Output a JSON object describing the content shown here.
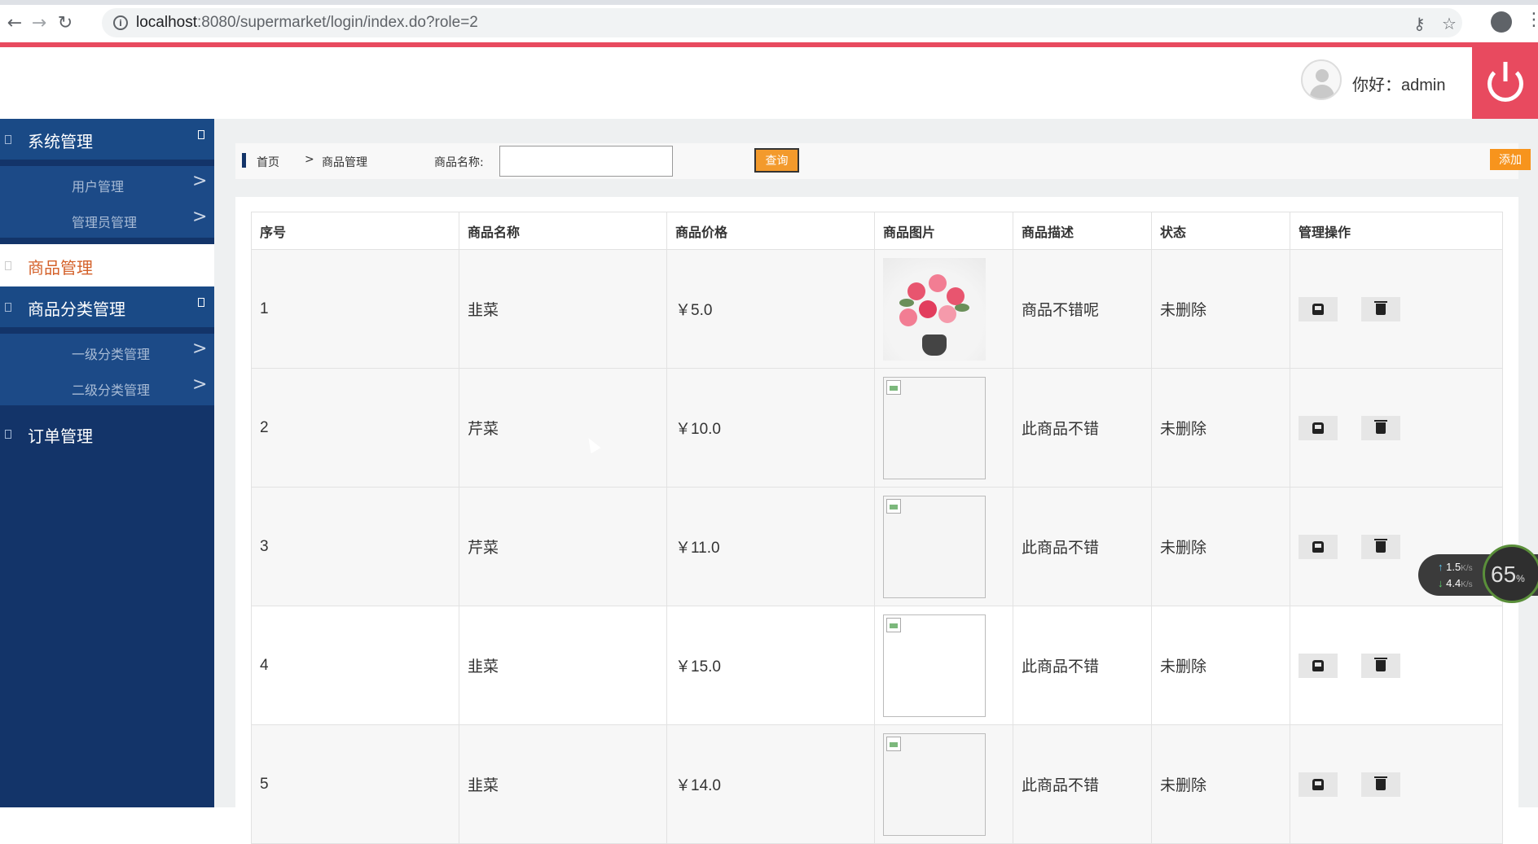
{
  "browser": {
    "url_host": "localhost",
    "url_rest": ":8080/supermarket/login/index.do?role=2",
    "back_icon": "arrow-left-icon",
    "forward_icon": "arrow-right-icon",
    "reload_icon": "reload-icon"
  },
  "header": {
    "greeting": "你好：admin",
    "accent_color": "#e84a5f"
  },
  "sidebar": {
    "groups": [
      {
        "label": "系统管理",
        "items": [
          {
            "label": "用户管理",
            "arrow": ">"
          },
          {
            "label": "管理员管理",
            "arrow": ">"
          }
        ]
      },
      {
        "label": "商品管理",
        "active": true
      },
      {
        "label": "商品分类管理",
        "items": [
          {
            "label": "一级分类管理",
            "arrow": ">"
          },
          {
            "label": "二级分类管理",
            "arrow": ">"
          }
        ]
      },
      {
        "label": "订单管理"
      }
    ],
    "bg_color": "#133469"
  },
  "toolbar": {
    "breadcrumb_home": "首页",
    "breadcrumb_sep": ">",
    "breadcrumb_current": "商品管理",
    "search_label": "商品名称:",
    "search_value": "",
    "search_button": "查询",
    "add_button": "添加"
  },
  "table": {
    "headers": [
      "序号",
      "商品名称",
      "商品价格",
      "商品图片",
      "商品描述",
      "状态",
      "管理操作"
    ],
    "rows": [
      {
        "id": "1",
        "name": "韭菜",
        "price": "￥5.0",
        "image": "flower-photo",
        "desc": "商品不错呢",
        "status": "未删除"
      },
      {
        "id": "2",
        "name": "芹菜",
        "price": "￥10.0",
        "image": "broken-image",
        "desc": "此商品不错",
        "status": "未删除"
      },
      {
        "id": "3",
        "name": "芹菜",
        "price": "￥11.0",
        "image": "broken-image",
        "desc": "此商品不错",
        "status": "未删除"
      },
      {
        "id": "4",
        "name": "韭菜",
        "price": "￥15.0",
        "image": "broken-image",
        "desc": "此商品不错",
        "status": "未删除"
      },
      {
        "id": "5",
        "name": "韭菜",
        "price": "￥14.0",
        "image": "broken-image",
        "desc": "此商品不错",
        "status": "未删除"
      }
    ]
  },
  "net_widget": {
    "up": "1.5",
    "down": "4.4",
    "unit": "K/s",
    "percent": "65",
    "percent_sign": "%"
  }
}
